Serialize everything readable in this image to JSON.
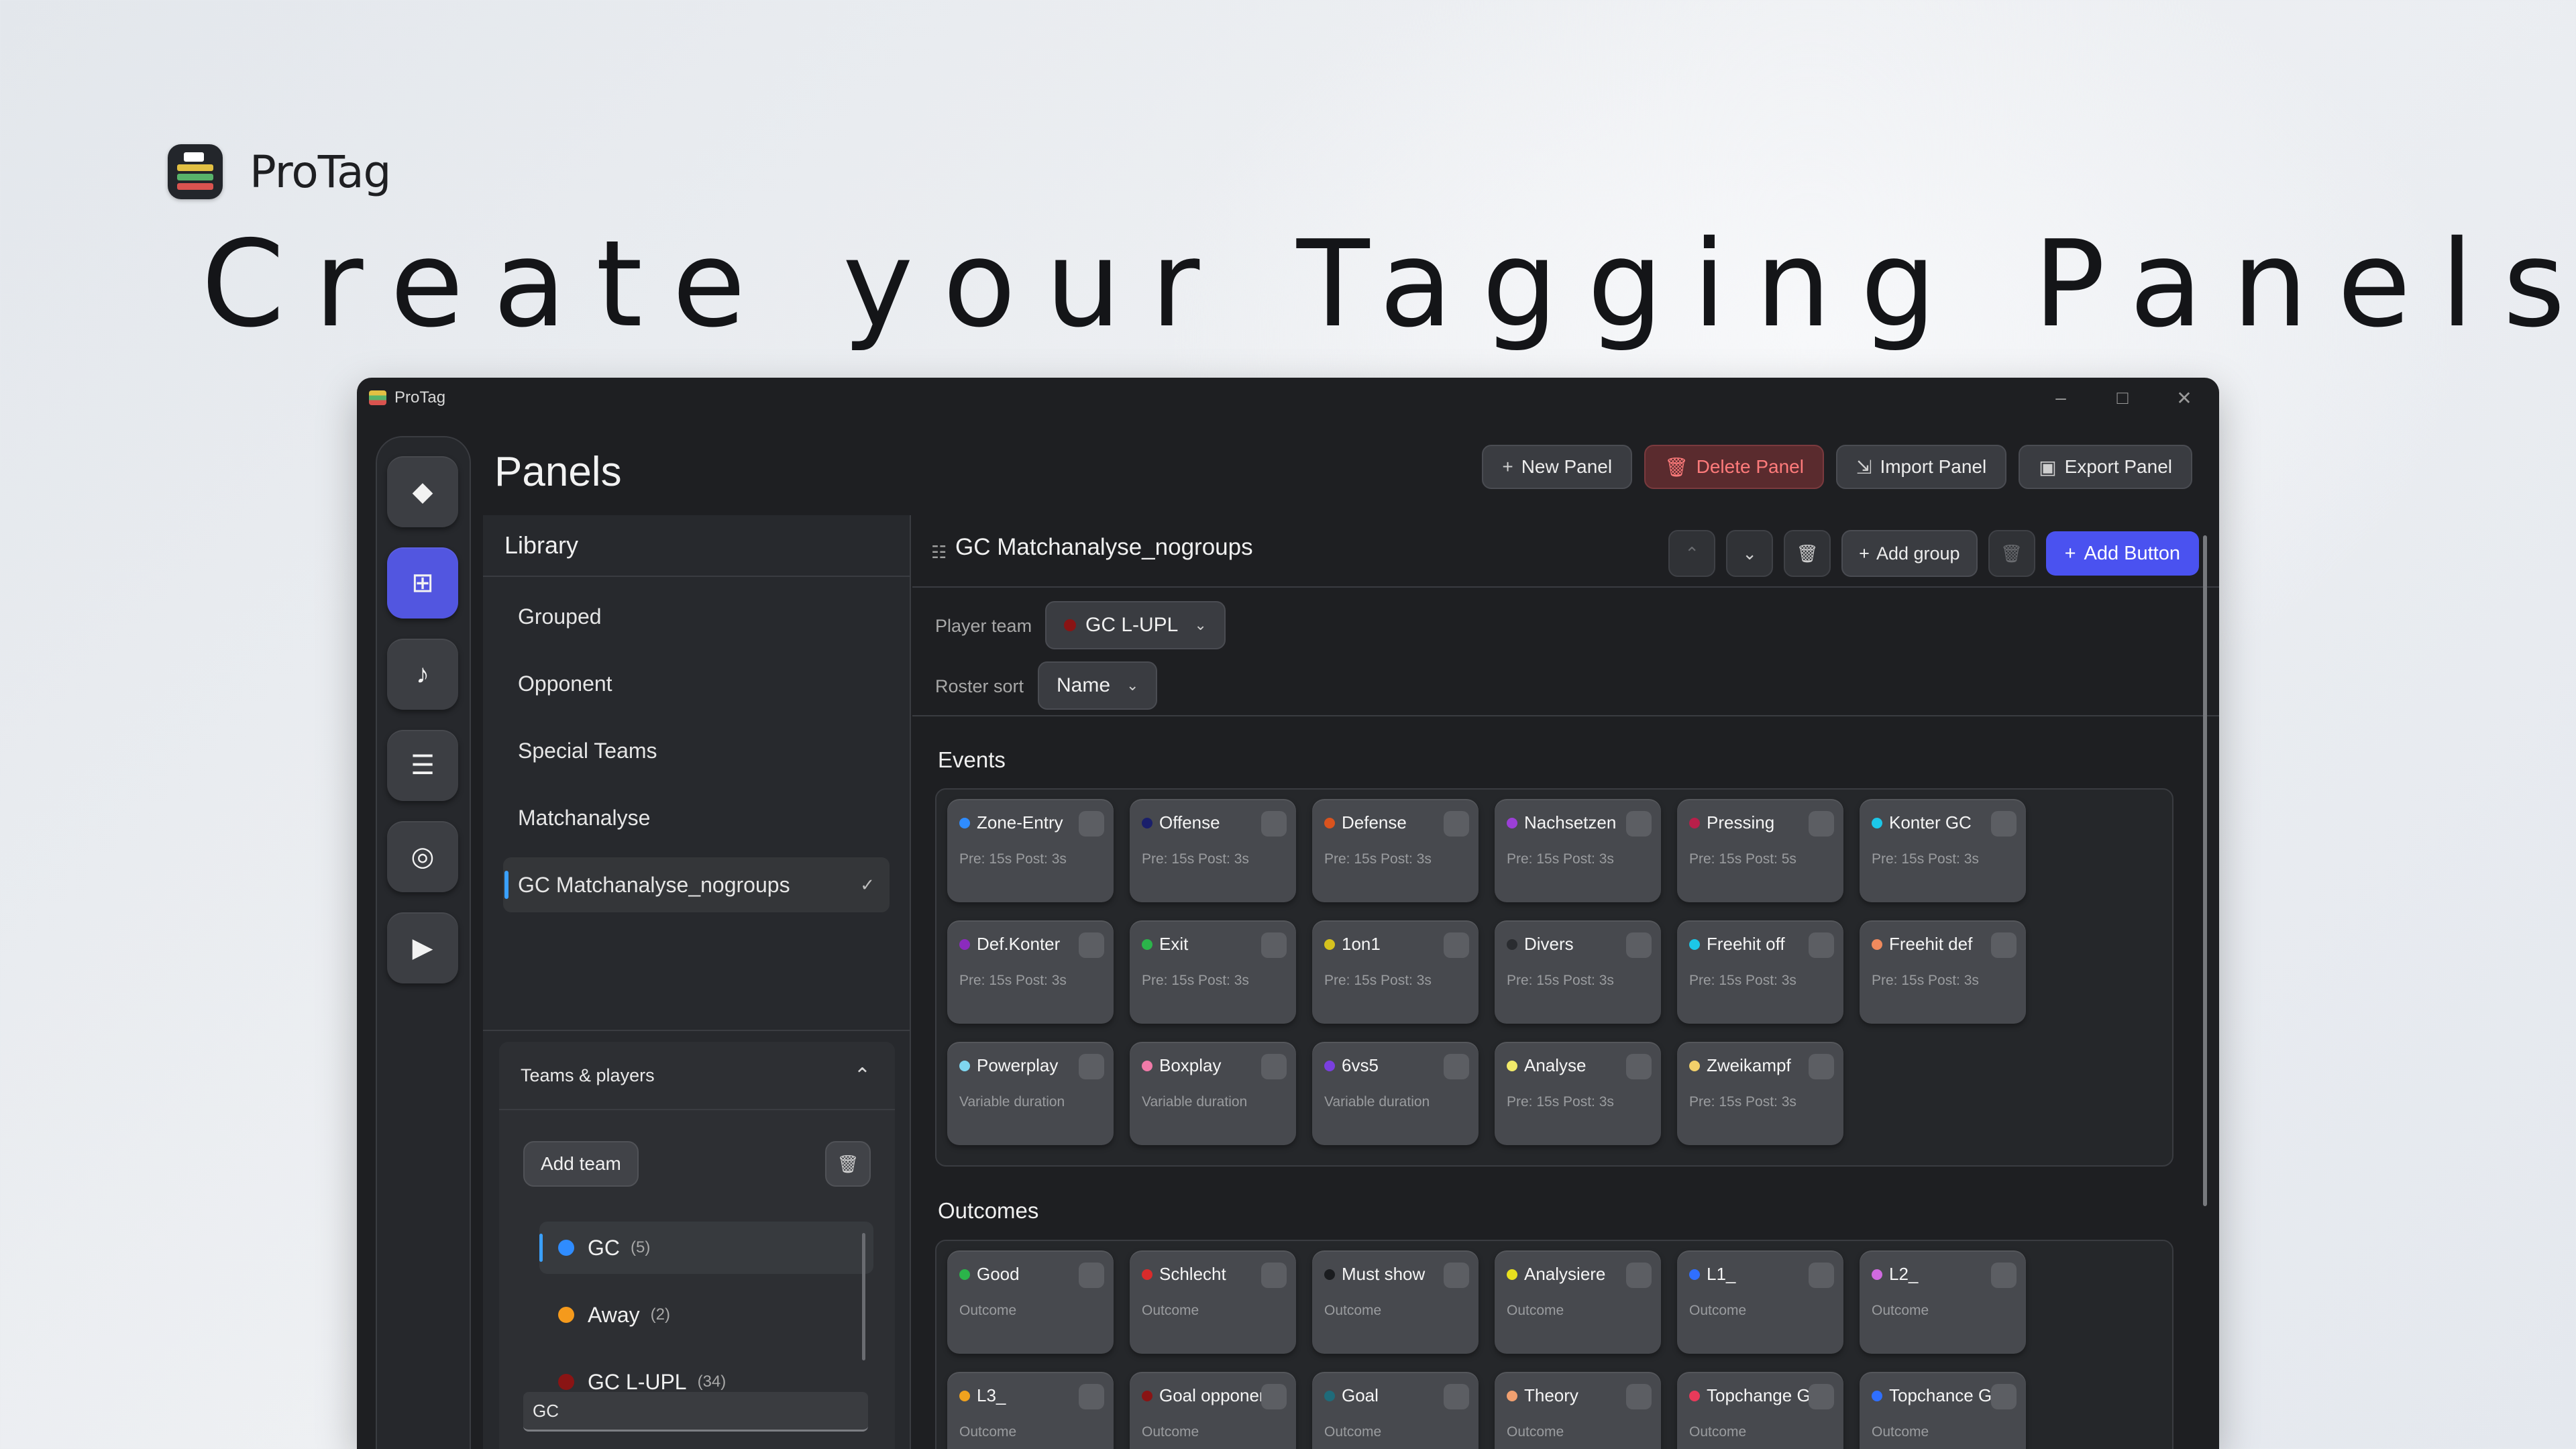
{
  "app": {
    "name": "ProTag"
  },
  "hero": {
    "headline": "Create your Tagging Panels"
  },
  "window": {
    "title": "ProTag",
    "controls": {
      "minimize": "–",
      "maximize": "□",
      "close": "✕"
    }
  },
  "rail": {
    "items": [
      {
        "name": "diamond-icon",
        "glyph": "◆"
      },
      {
        "name": "grid-icon",
        "glyph": "⊞"
      },
      {
        "name": "music-icon",
        "glyph": "♪"
      },
      {
        "name": "list-icon",
        "glyph": "☰"
      },
      {
        "name": "target-icon",
        "glyph": "◎"
      },
      {
        "name": "play-icon",
        "glyph": "▶"
      }
    ],
    "active_index": 1
  },
  "page": {
    "title": "Panels"
  },
  "toolbar": {
    "new_panel": "New Panel",
    "delete_panel": "Delete Panel",
    "import_panel": "Import Panel",
    "export_panel": "Export Panel"
  },
  "library": {
    "title": "Library",
    "items": [
      "Grouped",
      "Opponent",
      "Special Teams",
      "Matchanalyse",
      "GC Matchanalyse_nogroups"
    ],
    "selected_index": 4
  },
  "teams": {
    "title": "Teams & players",
    "add_team": "Add team",
    "list": [
      {
        "name": "GC",
        "count": "(5)",
        "color": "#2f8cff"
      },
      {
        "name": "Away",
        "count": "(2)",
        "color": "#f59a1c"
      },
      {
        "name": "GC L-UPL",
        "count": "(34)",
        "color": "#8a1414"
      }
    ],
    "input_value": "GC"
  },
  "editor": {
    "title": "GC Matchanalyse_nogroups",
    "add_group": "Add group",
    "add_button": "Add Button",
    "player_team_label": "Player team",
    "player_team_value": "GC L-UPL",
    "player_team_color": "#8a1414",
    "roster_sort_label": "Roster sort",
    "roster_sort_value": "Name"
  },
  "events": {
    "title": "Events",
    "cards": [
      {
        "name": "Zone-Entry",
        "color": "#2f8cff",
        "sub": "Pre: 15s   Post: 3s"
      },
      {
        "name": "Offense",
        "color": "#1a1f6b",
        "sub": "Pre: 15s   Post: 3s"
      },
      {
        "name": "Defense",
        "color": "#d9531e",
        "sub": "Pre: 15s   Post: 3s"
      },
      {
        "name": "Nachsetzen",
        "color": "#9b3fd6",
        "sub": "Pre: 15s   Post: 3s"
      },
      {
        "name": "Pressing",
        "color": "#b81f4a",
        "sub": "Pre: 15s   Post: 5s"
      },
      {
        "name": "Konter GC",
        "color": "#1cc7e8",
        "sub": "Pre: 15s   Post: 3s"
      },
      {
        "name": "Def.Konter",
        "color": "#8b2bbd",
        "sub": "Pre: 15s   Post: 3s"
      },
      {
        "name": "Exit",
        "color": "#2bb44a",
        "sub": "Pre: 15s   Post: 3s"
      },
      {
        "name": "1on1",
        "color": "#d6c21e",
        "sub": "Pre: 15s   Post: 3s"
      },
      {
        "name": "Divers",
        "color": "#2a2c30",
        "sub": "Pre: 15s   Post: 3s"
      },
      {
        "name": "Freehit off",
        "color": "#1cc7e8",
        "sub": "Pre: 15s   Post: 3s"
      },
      {
        "name": "Freehit def",
        "color": "#f08a5d",
        "sub": "Pre: 15s   Post: 3s"
      },
      {
        "name": "Powerplay",
        "color": "#7fd6f0",
        "sub": "Variable duration"
      },
      {
        "name": "Boxplay",
        "color": "#f07aa8",
        "sub": "Variable duration"
      },
      {
        "name": "6vs5",
        "color": "#7a3fe0",
        "sub": "Variable duration"
      },
      {
        "name": "Analyse",
        "color": "#f2ea6a",
        "sub": "Pre: 15s   Post: 3s"
      },
      {
        "name": "Zweikampf",
        "color": "#f2d06a",
        "sub": "Pre: 15s   Post: 3s"
      }
    ]
  },
  "outcomes": {
    "title": "Outcomes",
    "cards": [
      {
        "name": "Good",
        "color": "#2bb44a",
        "sub": "Outcome"
      },
      {
        "name": "Schlecht",
        "color": "#d92b2b",
        "sub": "Outcome"
      },
      {
        "name": "Must show",
        "color": "#1a1c1f",
        "sub": "Outcome"
      },
      {
        "name": "Analysiere",
        "color": "#e8e01e",
        "sub": "Outcome"
      },
      {
        "name": "L1_",
        "color": "#2f6fff",
        "sub": "Outcome"
      },
      {
        "name": "L2_",
        "color": "#d06ae0",
        "sub": "Outcome"
      },
      {
        "name": "L3_",
        "color": "#f0a21e",
        "sub": "Outcome"
      },
      {
        "name": "Goal opponent",
        "color": "#8a1414",
        "sub": "Outcome"
      },
      {
        "name": "Goal",
        "color": "#1f6b7a",
        "sub": "Outcome"
      },
      {
        "name": "Theory",
        "color": "#f0a070",
        "sub": "Outcome"
      },
      {
        "name": "Topchange G...",
        "color": "#e83a5a",
        "sub": "Outcome"
      },
      {
        "name": "Topchance GC",
        "color": "#2f6fff",
        "sub": "Outcome"
      }
    ]
  }
}
